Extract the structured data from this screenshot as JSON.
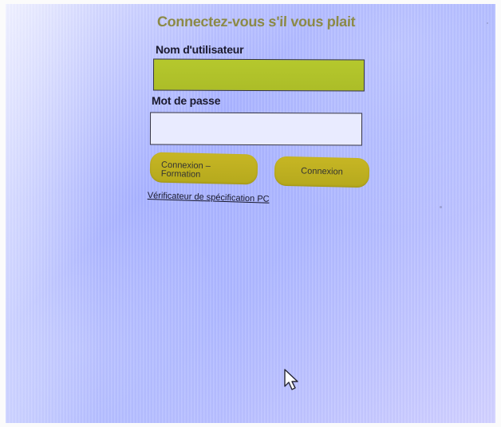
{
  "login": {
    "title": "Connectez-vous s'il vous plait",
    "username": {
      "label": "Nom d'utilisateur",
      "value": "",
      "placeholder": ""
    },
    "password": {
      "label": "Mot de passe",
      "value": "",
      "placeholder": ""
    },
    "buttons": {
      "training_label": "Connexion –\nFormation",
      "login_label": "Connexion"
    },
    "spec_link": "Vérificateur de spécification PC"
  },
  "cursor": {
    "icon": "mouse-pointer-icon"
  },
  "colors": {
    "title": "#8c8a47",
    "username_field": "#b5c82d",
    "button": "#c7b624",
    "background": "#aeb8ff"
  }
}
